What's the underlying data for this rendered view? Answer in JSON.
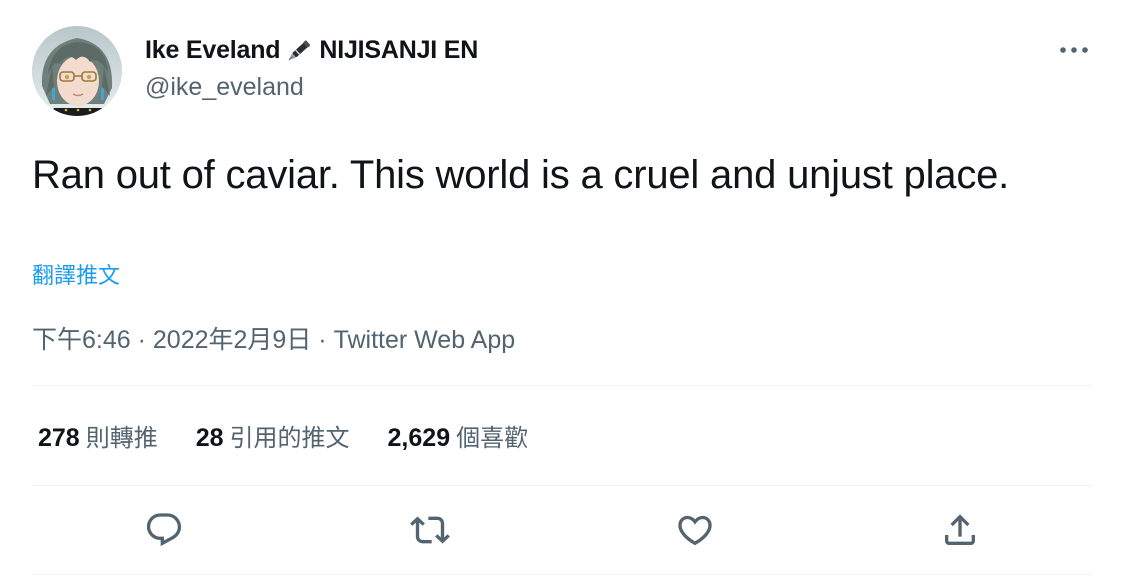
{
  "author": {
    "display_name_part1": "Ike Eveland",
    "display_name_part2": "NIJISANJI EN",
    "handle": "@ike_eveland",
    "avatar_icon": "avatar-image",
    "name_emoji_icon": "fountain-pen-icon"
  },
  "tweet": {
    "text": "Ran out of caviar. This world is a cruel and unjust place.",
    "translate_label": "翻譯推文",
    "time": "下午6:46",
    "date": "2022年2月9日",
    "separator": "·",
    "source": "Twitter Web App"
  },
  "stats": {
    "retweets_count": "278",
    "retweets_label": "則轉推",
    "quotes_count": "28",
    "quotes_label": "引用的推文",
    "likes_count": "2,629",
    "likes_label": "個喜歡"
  },
  "colors": {
    "text_primary": "#0f1419",
    "text_secondary": "#536471",
    "link": "#1d9bf0",
    "divider": "#eff3f4"
  },
  "icons": {
    "more": "more-horizontal-icon",
    "reply": "reply-icon",
    "retweet": "retweet-icon",
    "like": "heart-icon",
    "share": "share-icon"
  }
}
